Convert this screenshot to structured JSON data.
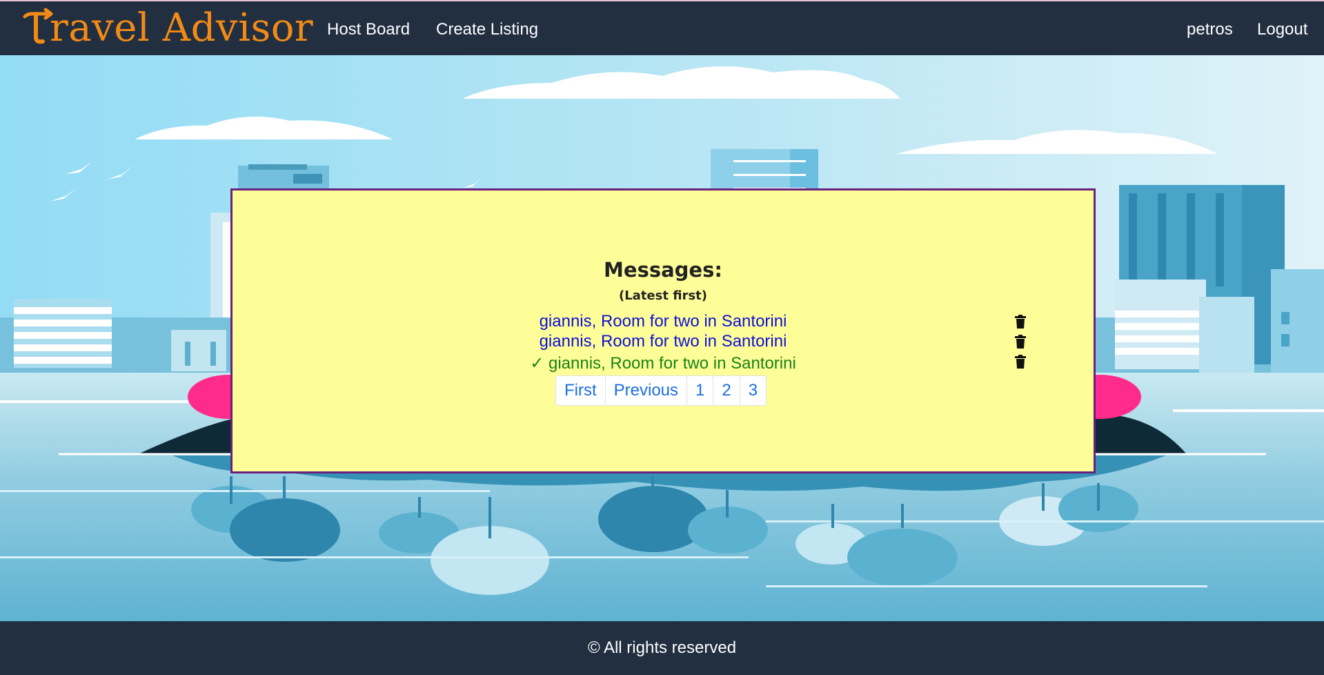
{
  "nav": {
    "brand": "Travel Advisor",
    "links": [
      "Host Board",
      "Create Listing"
    ],
    "user": "petros",
    "logout": "Logout"
  },
  "messages": {
    "title": "Messages:",
    "subtitle": "(Latest first)",
    "items": [
      {
        "text": "giannis, Room for two in Santorini",
        "read": false
      },
      {
        "text": "giannis, Room for two in Santorini",
        "read": false
      },
      {
        "text": "giannis, Room for two in Santorini",
        "read": true
      }
    ],
    "read_mark": "✓",
    "pagination": [
      "First",
      "Previous",
      "1",
      "2",
      "3"
    ]
  },
  "footer": {
    "text": "© All rights reserved"
  },
  "colors": {
    "navbar": "#212f41",
    "brand": "#f28a16",
    "panel": "#fefe98",
    "panel_border": "#6b1f7c",
    "unread_link": "#0f0fd6",
    "read_link": "#1a8217",
    "page_link": "#1a6fe0"
  },
  "icons": {
    "delete": "trash-icon",
    "read": "checkmark-icon",
    "logo": "arrow-T-logo-icon"
  }
}
